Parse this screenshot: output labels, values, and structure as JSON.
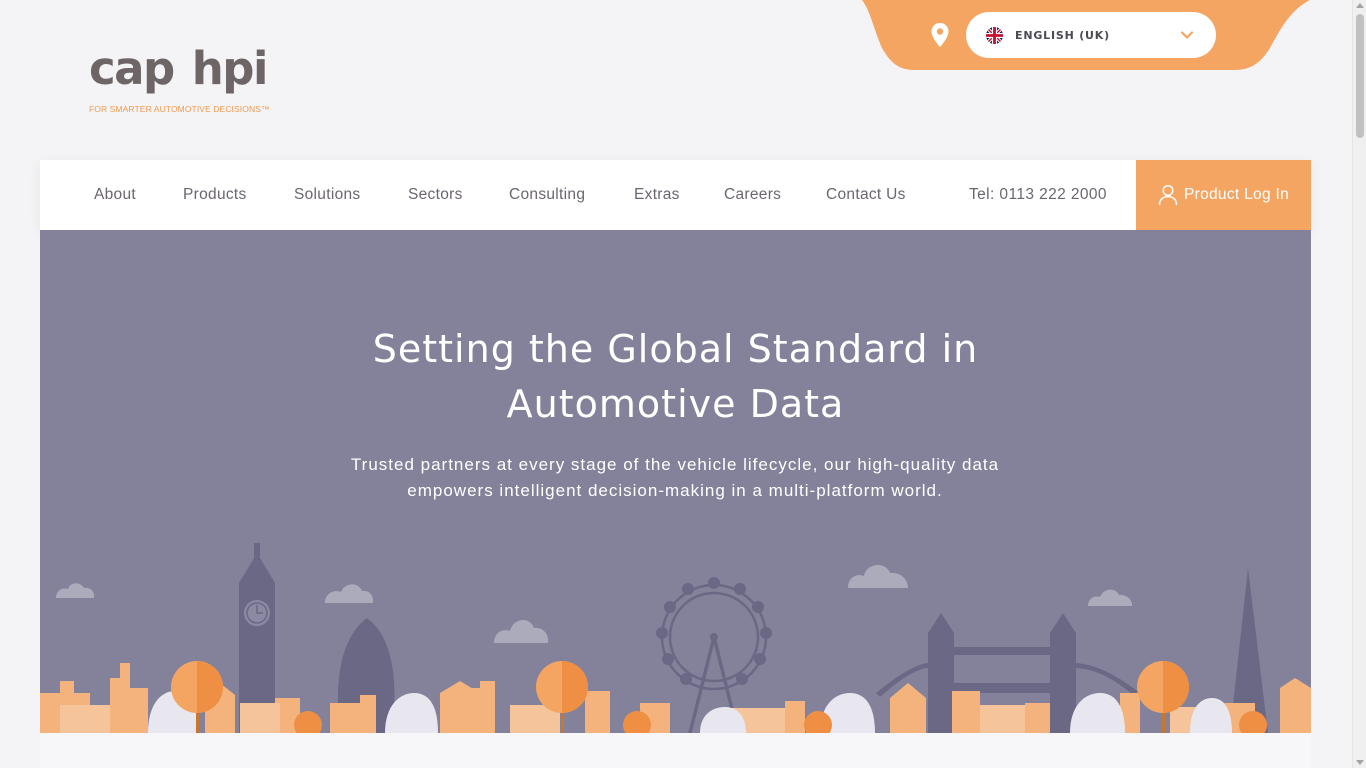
{
  "logo": {
    "word_cap": "cap",
    "word_hpi": "hpi",
    "tagline": "FOR SMARTER AUTOMOTIVE DECISIONS™"
  },
  "language": {
    "selected": "ENGLISH (UK)",
    "flag_icon": "uk-flag-icon",
    "location_icon": "location-pin-icon",
    "dropdown_icon": "chevron-down-icon",
    "accent_color": "#f5a562"
  },
  "nav": {
    "items": [
      {
        "label": "About"
      },
      {
        "label": "Products"
      },
      {
        "label": "Solutions"
      },
      {
        "label": "Sectors"
      },
      {
        "label": "Consulting"
      },
      {
        "label": "Extras"
      },
      {
        "label": "Careers"
      },
      {
        "label": "Contact Us"
      }
    ],
    "tel": "Tel: 0113 222 2000",
    "login_label": "Product Log In",
    "login_icon": "user-icon"
  },
  "hero": {
    "title_line1": "Setting the Global Standard in",
    "title_line2": "Automotive Data",
    "subtitle": "Trusted partners at every stage of the vehicle lifecycle, our high-quality data empowers intelligent decision-making in a multi-platform world.",
    "background_color": "#84829a"
  }
}
